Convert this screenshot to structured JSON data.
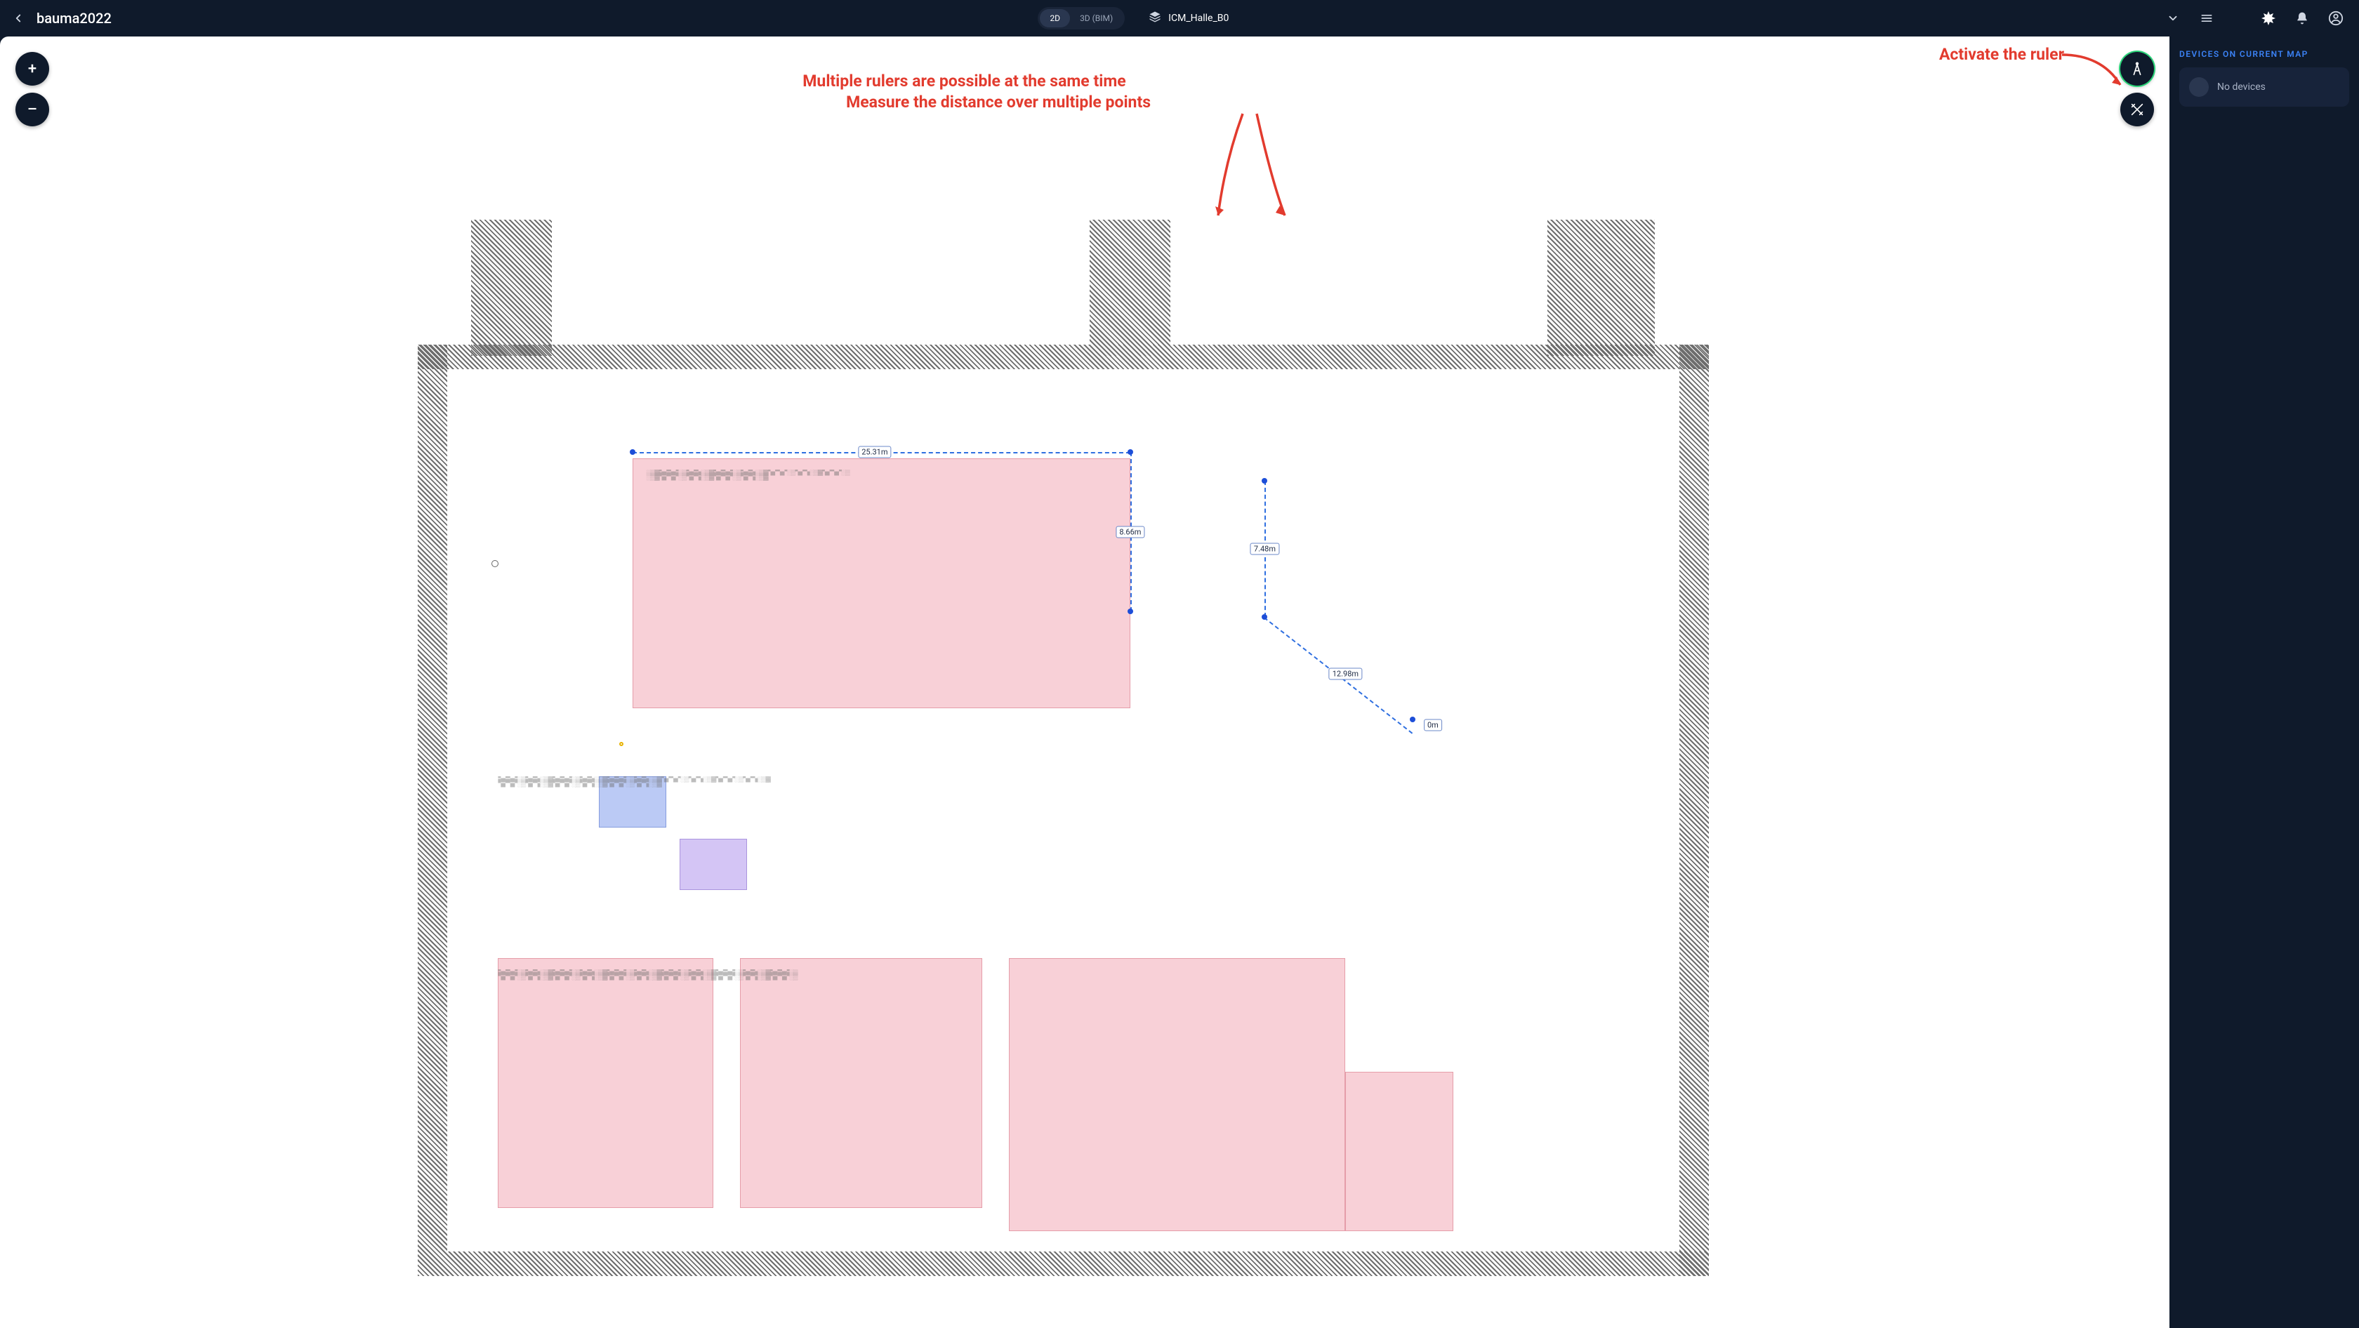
{
  "header": {
    "project_title": "bauma2022",
    "view_modes": {
      "two_d": "2D",
      "three_d": "3D (BIM)",
      "active": "2D"
    },
    "map_name": "ICM_Halle_B0"
  },
  "zoom": {
    "in_label": "+",
    "out_label": "–"
  },
  "sidebar": {
    "title": "DEVICES ON CURRENT MAP",
    "empty_text": "No devices"
  },
  "tools": {
    "ruler_name": "ruler",
    "design_name": "design-tools"
  },
  "measurements": {
    "ruler1": {
      "segments": [
        {
          "label": "25.31m"
        },
        {
          "label": "8.66m"
        }
      ]
    },
    "ruler2": {
      "segments": [
        {
          "label": "7.48m"
        },
        {
          "label": "12.98m"
        },
        {
          "label": "0m"
        }
      ]
    }
  },
  "annotations": {
    "activate": "Activate the ruler",
    "multi1": "Multiple rulers are possible at the same time",
    "multi2": "Measure the distance over multiple points"
  },
  "colors": {
    "accent_blue": "#3b82f6",
    "ruler_blue": "#2f6fe0",
    "annot_red": "#e23b2e",
    "zone_pink": "rgba(235,120,140,.35)",
    "active_green": "#2bd479",
    "bg_dark": "#0f1a2b"
  }
}
